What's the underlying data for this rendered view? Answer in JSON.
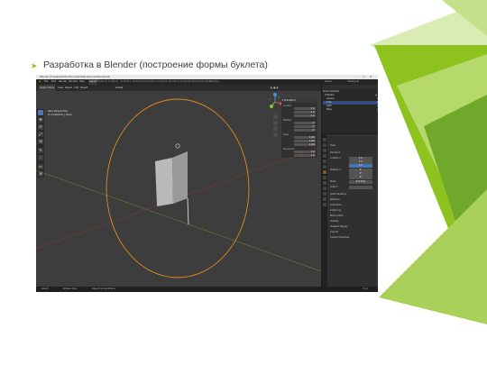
{
  "slide": {
    "title": "Разработка в Blender (построение формы буклета)",
    "bullet": "➤",
    "accent_colors": [
      "#8dc21f",
      "#b5d96a",
      "#6fa82a"
    ]
  },
  "blender": {
    "window_title": "Blender [C:\\Users\\Admin\\Documents\\Буклет\\untitled.blend]",
    "window_controls": [
      "–",
      "□",
      "✕"
    ],
    "menu": [
      "File",
      "Edit",
      "Render",
      "Window",
      "Help"
    ],
    "workspaces": [
      "Layout",
      "Modeling",
      "Sculpting",
      "UV Editing",
      "Texture Paint",
      "Shading",
      "Animation",
      "Rendering",
      "Compositing",
      "Geometry Nodes",
      "Scripting"
    ],
    "active_workspace": "Layout",
    "scene": "Scene",
    "view_layer": "ViewLayer",
    "viewport_header": {
      "mode": "Object Mode",
      "menus": [
        "View",
        "Select",
        "Add",
        "Object"
      ],
      "transform": "Global"
    },
    "tools": [
      "⬚",
      "✥",
      "⟳",
      "⤢",
      "⊞",
      "✎",
      "⟋",
      "▭",
      "⊕"
    ],
    "viewport_info": [
      "User Perspective",
      "(1) Collection | Cube"
    ],
    "n_panel": {
      "header": "Transform",
      "location_label": "Location",
      "location": [
        "0 m",
        "0 m",
        "0 m"
      ],
      "rotation_label": "Rotation",
      "rotation": [
        "0°",
        "0°",
        "0°"
      ],
      "scale_label": "Scale",
      "scale": [
        "1.000",
        "1.000",
        "1.000"
      ],
      "dimensions_label": "Dimensions",
      "dimensions": [
        "2 m",
        "2 m",
        "2 m"
      ]
    },
    "gizmo_axes": [
      "X",
      "Y",
      "Z"
    ],
    "outliner": {
      "rows": [
        {
          "label": "Scene Collection",
          "selected": false
        },
        {
          "label": "Collection",
          "selected": false
        },
        {
          "label": "Camera",
          "selected": false
        },
        {
          "label": "Cube",
          "selected": true
        },
        {
          "label": "Light",
          "selected": false
        },
        {
          "label": "Plane",
          "selected": false
        }
      ],
      "eye_icon": "eye-icon"
    },
    "properties": {
      "object_name": "Cube",
      "section": "Transform",
      "location_label": "Location X",
      "loc": [
        "0 m",
        "0 m",
        "0 m"
      ],
      "rotation_label": "Rotation X",
      "rot": [
        "0°",
        "0°",
        "0°"
      ],
      "mode_label": "Mode",
      "mode_value": "XYZ Euler",
      "scale_label": "Scale X",
      "sections": [
        "Delta Transform",
        "Relations",
        "Collections",
        "Instancing",
        "Motion Paths",
        "Visibility",
        "Viewport Display",
        "Line Art",
        "Custom Properties"
      ]
    },
    "statusbar": {
      "left": [
        "Select",
        "Rotate View",
        "Object Context Menu"
      ],
      "right": "3.4.1"
    }
  }
}
